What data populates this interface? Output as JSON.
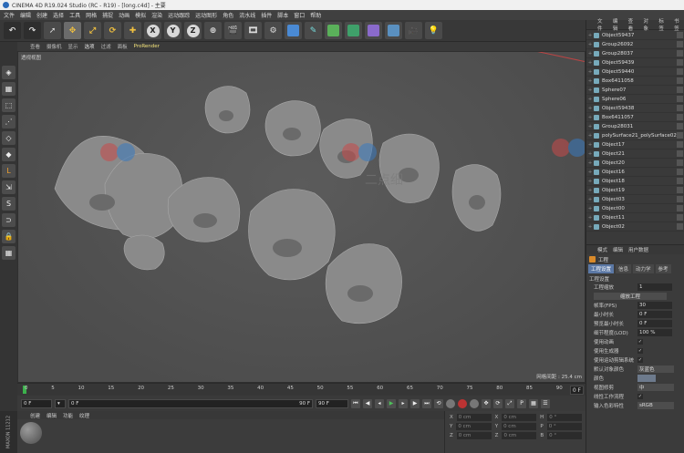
{
  "window": {
    "title": "CINEMA 4D R19.024 Studio (RC - R19) - [long.c4d] - 主要"
  },
  "menu": [
    "文件",
    "编辑",
    "创建",
    "选择",
    "工具",
    "网格",
    "捕捉",
    "动画",
    "模拟",
    "渲染",
    "运动跟踪",
    "运动图形",
    "角色",
    "流水线",
    "插件",
    "脚本",
    "窗口",
    "帮助"
  ],
  "toolbar": {
    "axis_x": "X",
    "axis_y": "Y",
    "axis_z": "Z"
  },
  "viewport": {
    "menu": [
      "查看",
      "摄像机",
      "显示",
      "选项",
      "过滤",
      "面板",
      "ProRender"
    ],
    "view_label": "透视视图",
    "grid_info": "网格间距 : 25.4 cm",
    "watermark_text": "二点细"
  },
  "timeline": {
    "ticks": [
      "0",
      "5",
      "10",
      "15",
      "20",
      "25",
      "30",
      "35",
      "40",
      "45",
      "50",
      "55",
      "60",
      "65",
      "70",
      "75",
      "80",
      "85",
      "90"
    ],
    "end_label": "0 F"
  },
  "transport": {
    "current_frame": "0 F",
    "start_frame": "0 F",
    "range_end": "90 F",
    "end_frame": "90 F"
  },
  "material_manager": {
    "menu": [
      "创建",
      "编辑",
      "功能",
      "纹理"
    ],
    "side_label": "MAXON 11212"
  },
  "coordinates": {
    "rows": [
      {
        "a": "X",
        "av": "0 cm",
        "b": "X",
        "bv": "0 cm",
        "c": "H",
        "cv": "0 °"
      },
      {
        "a": "Y",
        "av": "0 cm",
        "b": "Y",
        "bv": "0 cm",
        "c": "P",
        "cv": "0 °"
      },
      {
        "a": "Z",
        "av": "0 cm",
        "b": "Z",
        "bv": "0 cm",
        "c": "B",
        "cv": "0 °"
      }
    ]
  },
  "objects": {
    "menu": [
      "文件",
      "编辑",
      "查看",
      "对象",
      "标签",
      "书签"
    ],
    "items": [
      "Object59437",
      "Group26092",
      "Group28037",
      "Object59439",
      "Object59440",
      "Box6411058",
      "Sphere07",
      "Sphere06",
      "Object59438",
      "Box6411057",
      "Group28031",
      "polySurface21_polySurface021",
      "Object17",
      "Object21",
      "Object20",
      "Object16",
      "Object18",
      "Object19",
      "Object03",
      "Object00",
      "Object11",
      "Object02"
    ]
  },
  "attributes": {
    "menu": [
      "模式",
      "编辑",
      "用户数据"
    ],
    "title": "工程",
    "tabs": [
      "工程设置",
      "信息",
      "动力学",
      "参考"
    ],
    "section": "工程设置",
    "rows": [
      {
        "label": "工程缩放",
        "value": "1"
      },
      {
        "label": "缩放工程",
        "button": true
      },
      {
        "label": "帧率(FPS)",
        "value": "30"
      },
      {
        "label": "最小时长",
        "value": "0 F"
      },
      {
        "label": "预览最小时长",
        "value": "0 F"
      },
      {
        "label": "细节程度(LOD)",
        "value": "100 %"
      },
      {
        "label": "使用动画",
        "check": "✓"
      },
      {
        "label": "使用生成器",
        "check": "✓"
      },
      {
        "label": "使用运动剪辑系统",
        "check": "✓"
      },
      {
        "label": "默认对象颜色",
        "dropdown": "灰蓝色"
      },
      {
        "label": "颜色",
        "swatch": true
      },
      {
        "label": "视图修剪",
        "dropdown": "中"
      },
      {
        "label": "线性工作流程",
        "check": "✓"
      },
      {
        "label": "输入色彩特性",
        "dropdown": "sRGB"
      }
    ]
  }
}
